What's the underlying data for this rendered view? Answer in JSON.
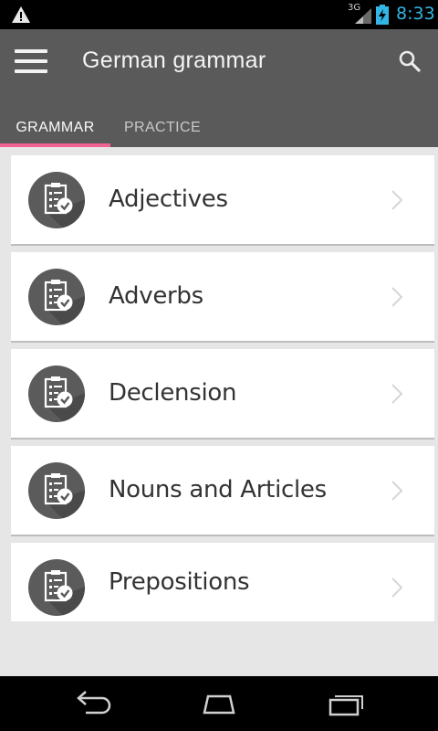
{
  "status_bar": {
    "network_type": "3G",
    "time": "8:33",
    "icons": [
      "warning-icon",
      "signal-icon",
      "battery-charging-icon"
    ]
  },
  "app_bar": {
    "title": "German grammar",
    "icons": [
      "menu-icon",
      "search-icon"
    ]
  },
  "tabs": [
    {
      "label": "GRAMMAR",
      "selected": true
    },
    {
      "label": "PRACTICE",
      "selected": false
    }
  ],
  "colors": {
    "app_bar": "#5a5a5a",
    "tab_indicator": "#f06292",
    "clock": "#33b5e5",
    "background": "#e6e6e6"
  },
  "topics": [
    {
      "label": "Adjectives",
      "icon": "checklist-icon"
    },
    {
      "label": "Adverbs",
      "icon": "checklist-icon"
    },
    {
      "label": "Declension",
      "icon": "checklist-icon"
    },
    {
      "label": "Nouns and Articles",
      "icon": "checklist-icon"
    },
    {
      "label": "Prepositions",
      "icon": "checklist-icon"
    }
  ],
  "nav_bar": {
    "icons": [
      "back-icon",
      "home-icon",
      "recent-apps-icon"
    ]
  }
}
